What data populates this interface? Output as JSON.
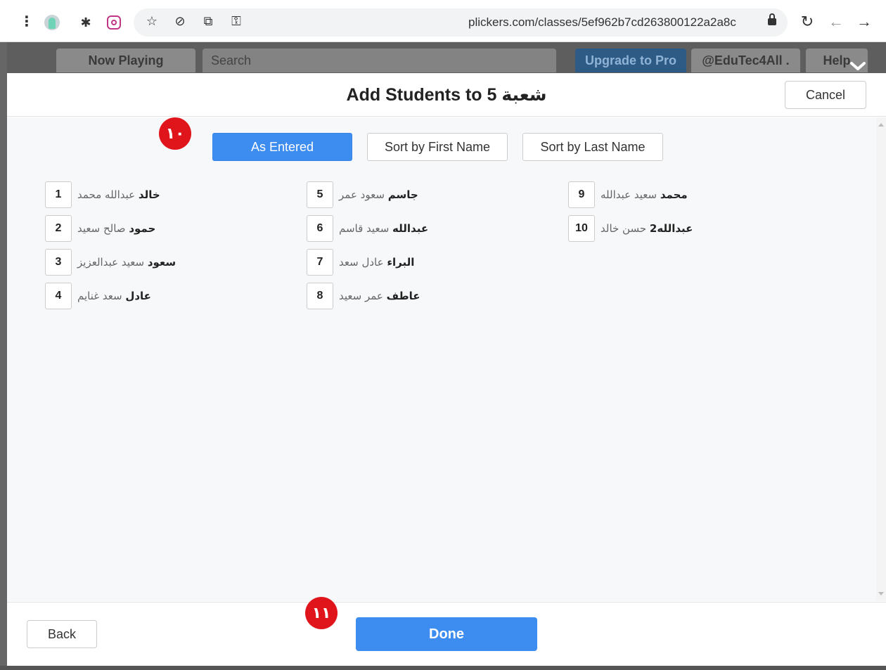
{
  "browser": {
    "url": "plickers.com/classes/5ef962b7cd263800122a2a8c",
    "menu_glyph": "⋮",
    "star_glyph": "☆",
    "eye_glyph": "⊘",
    "translate_glyph": "⧉",
    "key_glyph": "⚿",
    "reload_glyph": "↻",
    "back_glyph": "←",
    "forward_glyph": "→",
    "icons": [
      "avatar-extension-icon",
      "puzzle-icon",
      "instagram-icon",
      "star-icon",
      "hide-eye-icon",
      "translate-icon",
      "key-icon",
      "lock-icon",
      "reload-icon",
      "back-arrow-icon",
      "forward-arrow-icon"
    ]
  },
  "app_header": {
    "now_playing": "Now Playing",
    "search_placeholder": "Search",
    "upgrade": "Upgrade to Pro",
    "account": "@EduTec4All .",
    "help": "Help"
  },
  "modal": {
    "title": "Add Students to 5 شعبة",
    "cancel": "Cancel",
    "sort_options": {
      "as_entered": "As Entered",
      "first_name": "Sort by First Name",
      "last_name": "Sort by Last Name"
    },
    "active_sort": "As Entered",
    "markers": {
      "top": "١٠",
      "bottom": "١١"
    },
    "students": [
      {
        "num": "1",
        "rest": "عبدالله محمد",
        "bold": "خالد"
      },
      {
        "num": "2",
        "rest": "صالح سعيد",
        "bold": "حمود"
      },
      {
        "num": "3",
        "rest": "سعيد عبدالعزيز",
        "bold": "سعود"
      },
      {
        "num": "4",
        "rest": "سعد غنايم",
        "bold": "عادل"
      },
      {
        "num": "5",
        "rest": "سعود عمر",
        "bold": "جاسم"
      },
      {
        "num": "6",
        "rest": "سعيد قاسم",
        "bold": "عبدالله"
      },
      {
        "num": "7",
        "rest": "عادل سعد",
        "bold": "البراء"
      },
      {
        "num": "8",
        "rest": "عمر سعيد",
        "bold": "عاطف"
      },
      {
        "num": "9",
        "rest": "سعيد عبدالله",
        "bold": "محمد"
      },
      {
        "num": "10",
        "rest": "حسن خالد",
        "bold": "عبدالله2"
      }
    ],
    "back": "Back",
    "done": "Done"
  },
  "colors": {
    "primary": "#3d8cf0",
    "marker": "#e0141b"
  }
}
